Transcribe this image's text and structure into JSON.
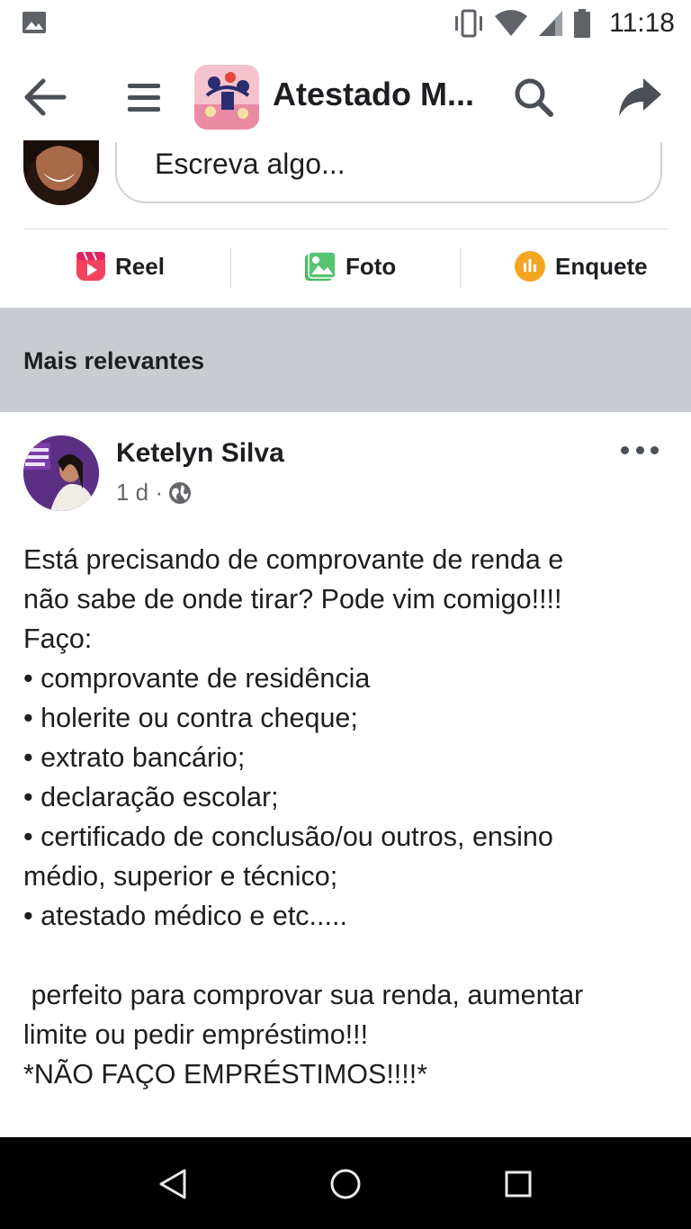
{
  "status_bar": {
    "time": "11:18",
    "icons": [
      "gallery-icon",
      "vibrate-icon",
      "wifi-icon",
      "signal-icon",
      "battery-icon"
    ]
  },
  "header": {
    "title": "Atestado M...",
    "icons": [
      "back-arrow-icon",
      "menu-icon",
      "search-icon",
      "share-icon"
    ]
  },
  "composer": {
    "placeholder": "Escreva algo...",
    "actions": [
      {
        "label": "Reel",
        "icon": "reel-icon",
        "color": "#f3425f"
      },
      {
        "label": "Foto",
        "icon": "photo-icon",
        "color": "#45bd62"
      },
      {
        "label": "Enquete",
        "icon": "poll-icon",
        "color": "#f7b928"
      }
    ]
  },
  "feed": {
    "section_label": "Mais relevantes"
  },
  "post": {
    "author": "Ketelyn Silva",
    "time": "1 d ·",
    "privacy_icon": "globe-icon",
    "body_lines": [
      "Está precisando de comprovante de renda e",
      "não sabe de onde tirar? Pode vim comigo!!!!",
      "Faço:",
      "• comprovante de residência",
      "• holerite ou contra cheque;",
      "• extrato bancário;",
      "• declaração escolar;",
      "• certificado de conclusão/ou outros, ensino",
      "médio, superior e técnico;",
      "• atestado médico e etc.....",
      "",
      " perfeito para comprovar sua renda, aumentar",
      "limite ou pedir empréstimo!!!",
      "*NÃO FAÇO EMPRÉSTIMOS!!!!*"
    ]
  },
  "nav_bar": {
    "icons": [
      "back-triangle-icon",
      "home-circle-icon",
      "recents-square-icon"
    ]
  },
  "colors": {
    "section_bg": "#c8ccd0",
    "text": "#1c1e21",
    "secondary_text": "#65676b"
  }
}
